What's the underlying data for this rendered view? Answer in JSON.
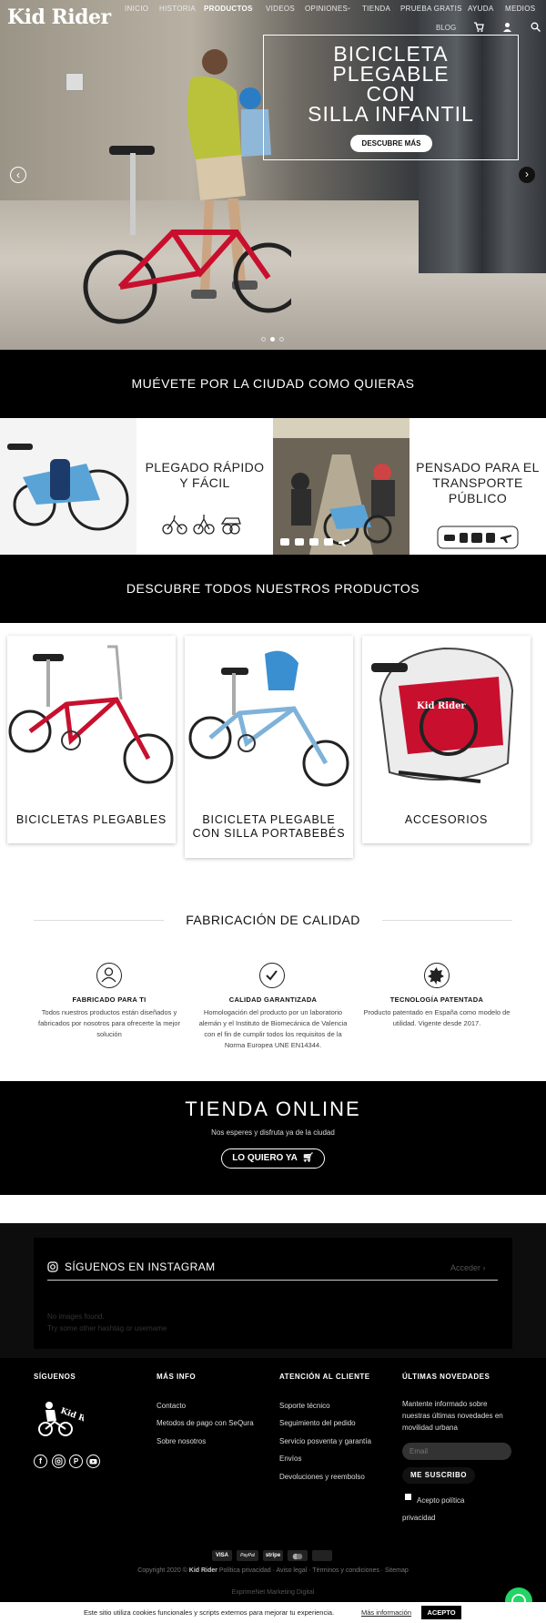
{
  "header": {
    "logo": "Kid Rider",
    "nav": [
      {
        "label": "INICIO"
      },
      {
        "label": "HISTORIA"
      },
      {
        "label": "PRODUCTOS"
      },
      {
        "label": "VIDEOS"
      },
      {
        "label": "OPINIONES"
      },
      {
        "label": "TIENDA"
      },
      {
        "label": "PRUEBA GRATIS"
      },
      {
        "label": "AYUDA"
      },
      {
        "label": "MEDIOS"
      }
    ],
    "blog": "BLOG"
  },
  "hero": {
    "title": "BICICLETA\nPLEGABLE\nCON\nSILLA INFANTIL",
    "button": "DESCUBRE MÁS",
    "slides": 3,
    "active_slide": 2
  },
  "section1": {
    "title": "MUÉVETE POR LA CIUDAD COMO QUIERAS"
  },
  "features": [
    {
      "title": "PLEGADO RÁPIDO\nY FÁCIL"
    },
    {
      "title": "PENSADO PARA EL\nTRANSPORTE\nPÚBLICO"
    }
  ],
  "section2": {
    "title": "DESCUBRE TODOS NUESTROS PRODUCTOS"
  },
  "products": [
    {
      "title": "BICICLETAS PLEGABLES"
    },
    {
      "title": "BICICLETA PLEGABLE\nCON SILLA PORTABEBÉS"
    },
    {
      "title": "ACCESORIOS"
    }
  ],
  "quality": {
    "title": "FABRICACIÓN DE CALIDAD",
    "items": [
      {
        "title": "FABRICADO PARA TI",
        "text": "Todos nuestros productos están diseñados y fabricados por nosotros para ofrecerte la mejor solución"
      },
      {
        "title": "CALIDAD GARANTIZADA",
        "text": "Homologación del producto por un laboratorio alemán y el Instituto de Biomecánica de Valencia con el fin de cumplir todos los requisitos de la Norma Europea UNE EN14344."
      },
      {
        "title": "TECNOLOGÍA PATENTADA",
        "text": "Producto patentado en España como modelo de utilidad. Vigente desde 2017."
      }
    ]
  },
  "shop": {
    "title": "TIENDA ONLINE",
    "subtitle": "Nos esperes y disfruta ya de la ciudad",
    "button": "LO QUIERO YA"
  },
  "instagram": {
    "title": "SÍGUENOS EN INSTAGRAM",
    "login": "Acceder",
    "empty1": "No images found.",
    "empty2": "Try some other hashtag or username"
  },
  "footer": {
    "col1": {
      "title": "SÍGUENOS",
      "logo": "Kid Rider"
    },
    "col2": {
      "title": "MÁS INFO",
      "links": [
        "Contacto",
        "Metodos de pago con SeQura",
        "Sobre nosotros"
      ]
    },
    "col3": {
      "title": "ATENCIÓN AL CLIENTE",
      "links": [
        "Soporte técnico",
        "Seguimiento del pedido",
        "Servicio posventa y garantía",
        "Envíos",
        "Devoluciones y reembolso"
      ]
    },
    "col4": {
      "title": "ÚLTIMAS NOVEDADES",
      "text": "Mantente informado sobre nuestras últimas novedades en movilidad urbana",
      "email_placeholder": "Email",
      "button": "ME SUSCRIBO",
      "privacy": "Acepto política privacidad"
    },
    "payments": [
      "VISA",
      "PayPal",
      "stripe"
    ],
    "copyright_prefix": "Copyright 2020 ©",
    "copyright_brand": "Kid Rider",
    "legal": "Política privacidad · Aviso legal · Términos y condiciones · Sitemap",
    "credit": "ExprimeNet Marketing Digital"
  },
  "cookie": {
    "text": "Este sitio utiliza cookies funcionales y scripts externos para mejorar tu experiencia.",
    "more": "Más información",
    "accept": "ACEPTO"
  }
}
